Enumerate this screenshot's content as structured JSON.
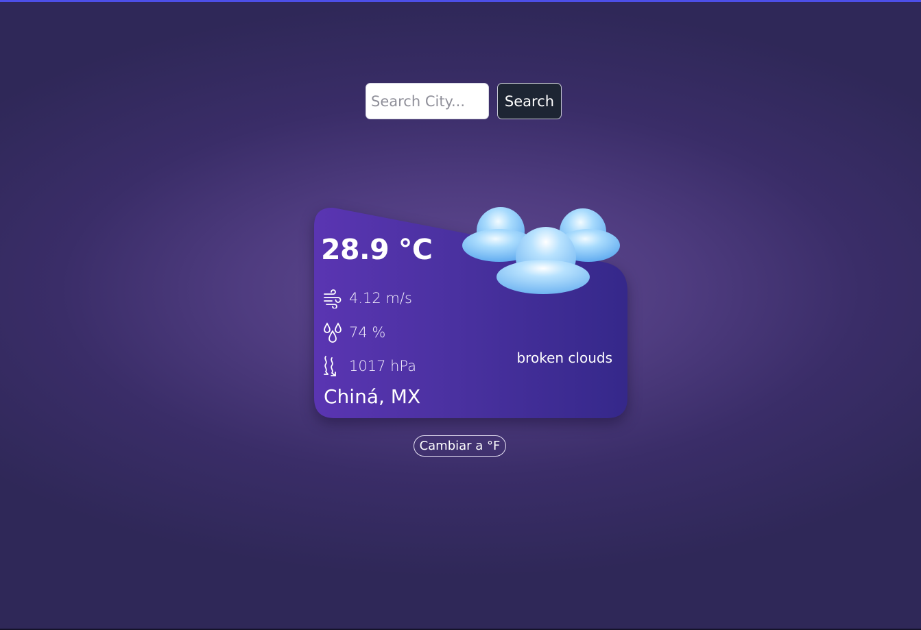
{
  "search": {
    "placeholder": "Search City...",
    "value": "",
    "button_label": "Search"
  },
  "weather": {
    "temperature": "28.9 °C",
    "wind": "4.12 m/s",
    "humidity": "74 %",
    "pressure": "1017 hPa",
    "condition": "broken clouds",
    "location": "Chiná, MX",
    "condition_icon": "broken-clouds-icon",
    "stat_icons": [
      "wind-icon",
      "humidity-icon",
      "pressure-icon"
    ]
  },
  "unit_toggle": {
    "label": "Cambiar a °F"
  },
  "colors": {
    "accent_line": "#4d4fe8",
    "card_left": "#5a35b2",
    "card_right": "#35288a",
    "cloud": "#7fc1f7",
    "button_dark": "#1d2533"
  }
}
